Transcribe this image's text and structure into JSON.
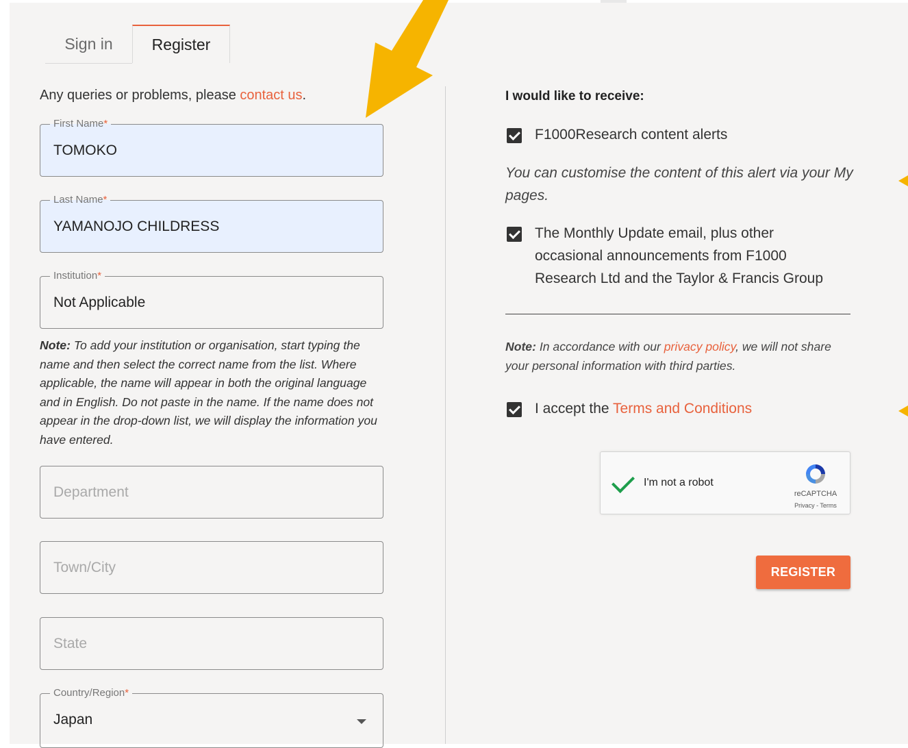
{
  "tabs": [
    {
      "label": "Sign in",
      "active": false
    },
    {
      "label": "Register",
      "active": true
    }
  ],
  "intro": {
    "text": "Any queries or problems, please ",
    "link": "contact us",
    "suffix": "."
  },
  "form": {
    "first_name": {
      "label": "First Name",
      "required": "*",
      "value": "TOMOKO"
    },
    "last_name": {
      "label": "Last Name",
      "required": "*",
      "value": "YAMANOJO CHILDRESS"
    },
    "institution": {
      "label": "Institution",
      "required": "*",
      "value": "Not Applicable"
    },
    "institution_note": {
      "bold": "Note:",
      "text": " To add your institution or organisation, start typing the name and then select the correct name from the list. Where applicable, the name will appear in both the original language and in English. Do not paste in the name. If the name does not appear in the drop-down list, we will display the information you have entered."
    },
    "department": {
      "placeholder": "Department"
    },
    "town_city": {
      "placeholder": "Town/City"
    },
    "state": {
      "placeholder": "State"
    },
    "country": {
      "label": "Country/Region",
      "required": "*",
      "value": "Japan"
    }
  },
  "preferences": {
    "title": "I would like to receive:",
    "content_alerts": {
      "label": "F1000Research content alerts",
      "checked": true
    },
    "customise_text": "You can customise the content of this alert via your My pages.",
    "monthly_update": {
      "label": "The Monthly Update email, plus other occasional announcements from F1000 Research Ltd and the Taylor & Francis Group",
      "checked": true
    },
    "privacy_note": {
      "bold": "Note:",
      "text": " In accordance with our ",
      "link": "privacy policy",
      "suffix": ", we will not share your personal information with third parties."
    },
    "terms": {
      "text": "I accept the ",
      "link": "Terms and Conditions",
      "checked": true
    }
  },
  "recaptcha": {
    "label": "I'm not a robot",
    "brand": "reCAPTCHA",
    "links": "Privacy - Terms"
  },
  "register_button": "REGISTER",
  "colors": {
    "accent": "#e8613c",
    "button": "#ef6c3e",
    "annotation_arrow": "#f6b400",
    "autofill": "#e8f0fe"
  }
}
